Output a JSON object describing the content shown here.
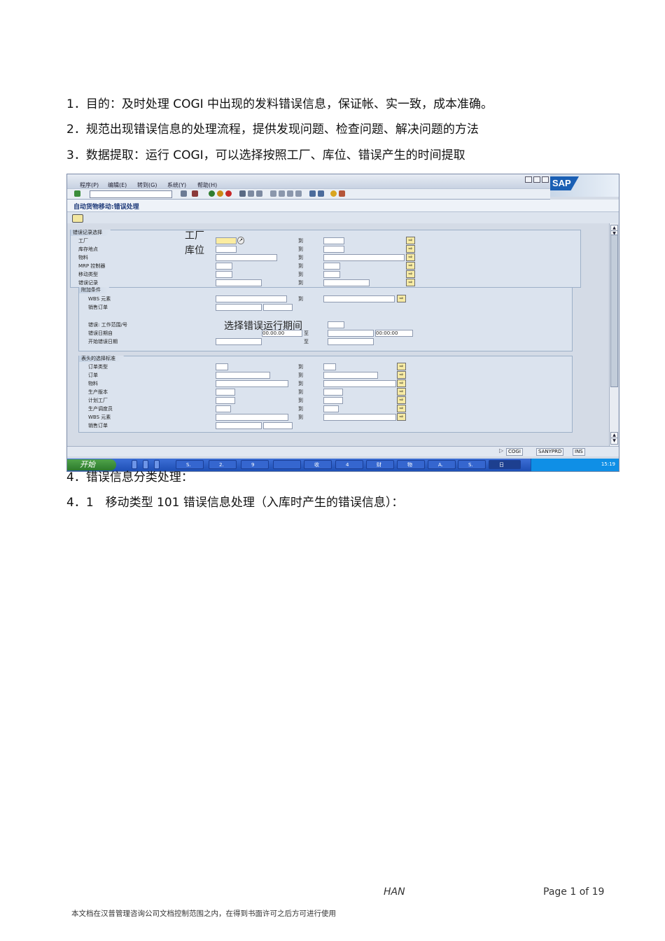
{
  "paragraphs": [
    "1．目的：及时处理 COGI 中出现的发料错误信息，保证帐、实一致，成本准确。",
    "2．规范出现错误信息的处理流程，提供发现问题、检查问题、解决问题的方法",
    "3．数据提取：运行 COGI，可以选择按照工厂、库位、错误产生的时间提取",
    "4．错误信息分类处理：",
    "4．1　移动类型 101 错误信息处理（入库时产生的错误信息）："
  ],
  "sap": {
    "menu": [
      "程序(P)",
      "编辑(E)",
      "转到(G)",
      "系统(Y)",
      "帮助(H)"
    ],
    "logo": "SAP",
    "title": "自动货物移动:错误处理",
    "group1": {
      "title": "错误记录选择",
      "rows": [
        {
          "label": "工厂",
          "to": "到"
        },
        {
          "label": "库存地点",
          "to": "到"
        },
        {
          "label": "物料",
          "to": "到"
        },
        {
          "label": "MRP 控制器",
          "to": "到"
        },
        {
          "label": "移动类型",
          "to": "到"
        },
        {
          "label": "错误记录",
          "to": "到"
        }
      ]
    },
    "group2": {
      "title": "附加条件",
      "rows": [
        {
          "label": "WBS 元素",
          "to": "到"
        },
        {
          "label": "销售订单",
          "to": ""
        },
        {
          "label": "错误: 工作范围/号",
          "to": ""
        },
        {
          "label": "错误日期自",
          "to": "至"
        },
        {
          "label": "开始错误日期",
          "to": "至"
        }
      ],
      "date_value": "00.00.00",
      "time_value": "00:00:00"
    },
    "group3": {
      "title": "表头的选择标准",
      "rows": [
        {
          "label": "订单类型",
          "to": "到"
        },
        {
          "label": "订单",
          "to": "到"
        },
        {
          "label": "物料",
          "to": "到"
        },
        {
          "label": "生产版本",
          "to": "到"
        },
        {
          "label": "计划工厂",
          "to": "到"
        },
        {
          "label": "生产调度员",
          "to": "到"
        },
        {
          "label": "WBS 元素",
          "to": "到"
        },
        {
          "label": "销售订单",
          "to": ""
        }
      ]
    },
    "annotations": {
      "plant": "工厂",
      "storage": "库位",
      "period": "选择错误运行期间"
    },
    "status": {
      "tcode": "COGI",
      "system": "SANYPRD",
      "mode": "INS"
    },
    "taskbar": {
      "start": "开始",
      "tasks": [
        "S.",
        "2.",
        "9",
        "",
        "收",
        "4",
        "财",
        "物",
        "A.",
        "S.",
        "日"
      ],
      "clock": "15:19"
    }
  },
  "footer": {
    "han": "HAN",
    "page": "Page 1 of 19",
    "note": "本文档在汉普管理咨询公司文档控制范围之内，在得到书面许可之后方可进行使用"
  }
}
